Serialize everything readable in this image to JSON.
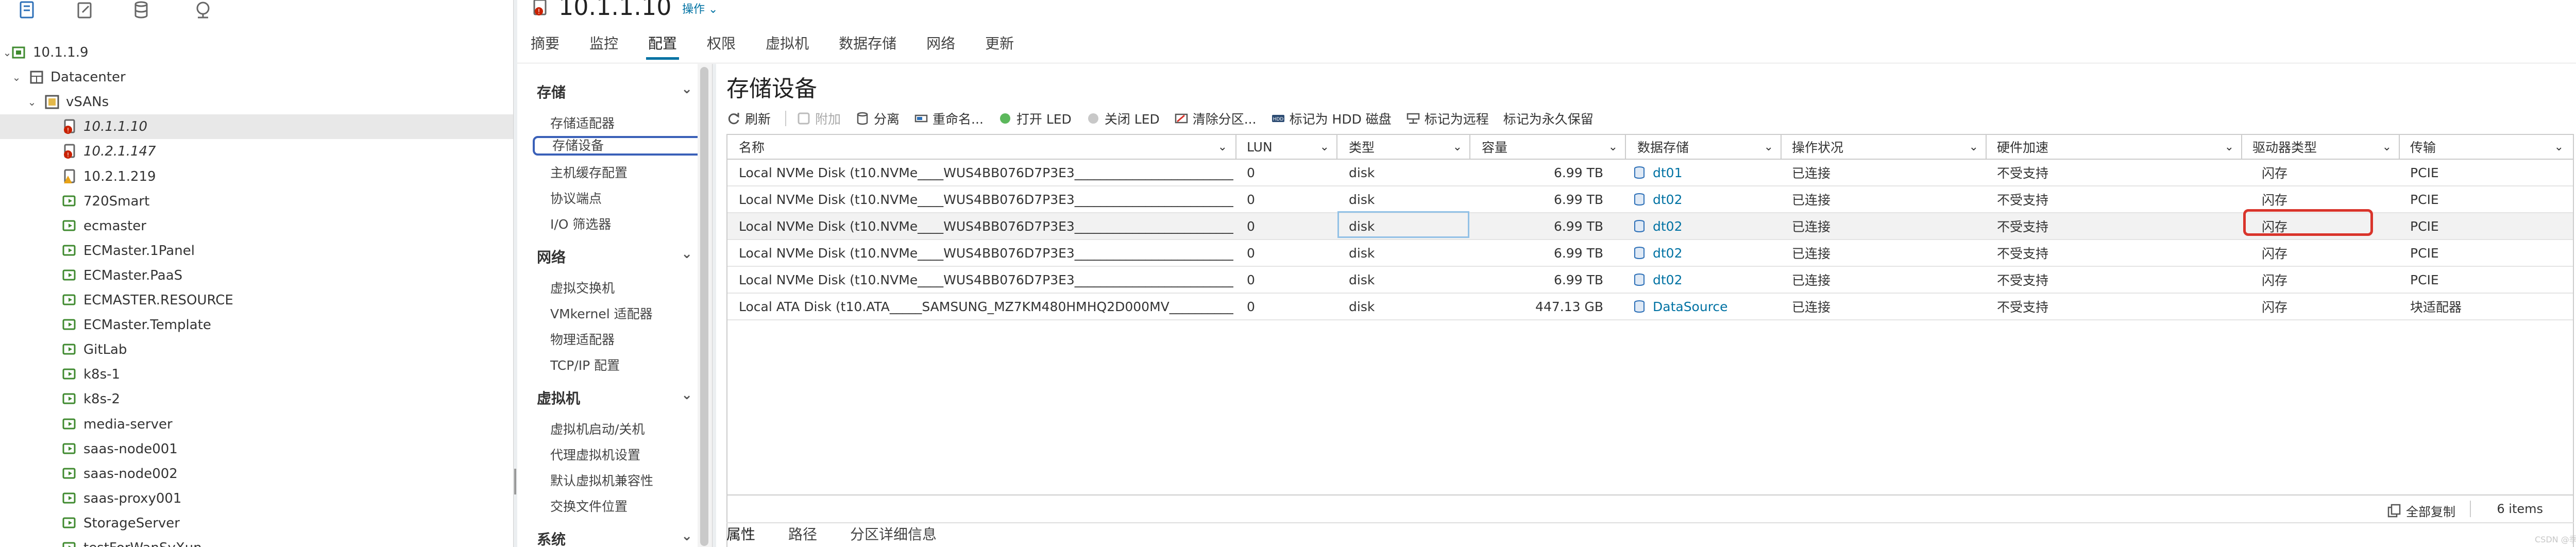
{
  "inventory": {
    "tree": [
      {
        "label": "10.1.1.9",
        "type": "vcenter"
      },
      {
        "label": "Datacenter",
        "type": "datacenter"
      },
      {
        "label": "vSANs",
        "type": "cluster"
      },
      {
        "label": "10.1.1.10",
        "type": "host-alert"
      },
      {
        "label": "10.2.1.147",
        "type": "host-alert"
      },
      {
        "label": "10.2.1.219",
        "type": "host-warn"
      },
      {
        "label": "720Smart",
        "type": "vm"
      },
      {
        "label": "ecmaster",
        "type": "vm"
      },
      {
        "label": "ECMaster.1Panel",
        "type": "vm"
      },
      {
        "label": "ECMaster.PaaS",
        "type": "vm"
      },
      {
        "label": "ECMASTER.RESOURCE",
        "type": "vm"
      },
      {
        "label": "ECMaster.Template",
        "type": "vm"
      },
      {
        "label": "GitLab",
        "type": "vm"
      },
      {
        "label": "k8s-1",
        "type": "vm"
      },
      {
        "label": "k8s-2",
        "type": "vm"
      },
      {
        "label": "media-server",
        "type": "vm"
      },
      {
        "label": "saas-node001",
        "type": "vm"
      },
      {
        "label": "saas-node002",
        "type": "vm"
      },
      {
        "label": "saas-proxy001",
        "type": "vm"
      },
      {
        "label": "StorageServer",
        "type": "vm"
      },
      {
        "label": "testForWanSyXun",
        "type": "vm"
      }
    ]
  },
  "header": {
    "title": "10.1.1.10",
    "actions_label": "操作",
    "tabs": [
      "摘要",
      "监控",
      "配置",
      "权限",
      "虚拟机",
      "数据存储",
      "网络",
      "更新"
    ]
  },
  "config_nav": {
    "storage": {
      "title": "存储",
      "items": [
        "存储适配器",
        "存储设备",
        "主机缓存配置",
        "协议端点",
        "I/O 筛选器"
      ]
    },
    "network": {
      "title": "网络",
      "items": [
        "虚拟交换机",
        "VMkernel 适配器",
        "物理适配器",
        "TCP/IP 配置"
      ]
    },
    "vm": {
      "title": "虚拟机",
      "items": [
        "虚拟机启动/关机",
        "代理虚拟机设置",
        "默认虚拟机兼容性",
        "交换文件位置"
      ]
    },
    "system": {
      "title": "系统"
    }
  },
  "main": {
    "title": "存储设备",
    "toolbar": [
      "刷新",
      "附加",
      "分离",
      "重命名...",
      "打开 LED",
      "关闭 LED",
      "清除分区...",
      "标记为 HDD 磁盘",
      "标记为远程",
      "标记为永久保留"
    ],
    "columns": [
      "名称",
      "LUN",
      "类型",
      "容量",
      "数据存储",
      "操作状况",
      "硬件加速",
      "驱动器类型",
      "传输"
    ],
    "rows": [
      {
        "name": "Local NVMe Disk (t10.NVMe____WUS4BB076D7P3E3__________________________...",
        "lun": "0",
        "type": "disk",
        "capacity": "6.99 TB",
        "datastore": "dt01",
        "status": "已连接",
        "hw_accel": "不受支持",
        "drive_type": "闪存",
        "transport": "PCIE"
      },
      {
        "name": "Local NVMe Disk (t10.NVMe____WUS4BB076D7P3E3__________________________...",
        "lun": "0",
        "type": "disk",
        "capacity": "6.99 TB",
        "datastore": "dt02",
        "status": "已连接",
        "hw_accel": "不受支持",
        "drive_type": "闪存",
        "transport": "PCIE"
      },
      {
        "name": "Local NVMe Disk (t10.NVMe____WUS4BB076D7P3E3__________________________...",
        "lun": "0",
        "type": "disk",
        "capacity": "6.99 TB",
        "datastore": "dt02",
        "status": "已连接",
        "hw_accel": "不受支持",
        "drive_type": "闪存",
        "transport": "PCIE"
      },
      {
        "name": "Local NVMe Disk (t10.NVMe____WUS4BB076D7P3E3__________________________...",
        "lun": "0",
        "type": "disk",
        "capacity": "6.99 TB",
        "datastore": "dt02",
        "status": "已连接",
        "hw_accel": "不受支持",
        "drive_type": "闪存",
        "transport": "PCIE"
      },
      {
        "name": "Local NVMe Disk (t10.NVMe____WUS4BB076D7P3E3__________________________...",
        "lun": "0",
        "type": "disk",
        "capacity": "6.99 TB",
        "datastore": "dt02",
        "status": "已连接",
        "hw_accel": "不受支持",
        "drive_type": "闪存",
        "transport": "PCIE"
      },
      {
        "name": "Local ATA Disk (t10.ATA_____SAMSUNG_MZ7KM480HMHQ2D000MV__________...",
        "lun": "0",
        "type": "disk",
        "capacity": "447.13 GB",
        "datastore": "DataSource",
        "status": "已连接",
        "hw_accel": "不受支持",
        "drive_type": "闪存",
        "transport": "块适配器"
      }
    ],
    "footer": {
      "copy_all": "全部复制",
      "items": "6 items"
    },
    "bottom_tabs": [
      "属性",
      "路径",
      "分区详细信息"
    ]
  },
  "watermark": "CSDN @季辰的STU",
  "colors": {
    "accent": "#0072a3",
    "highlight_box": "#d9342b",
    "alert": "#c92100"
  }
}
